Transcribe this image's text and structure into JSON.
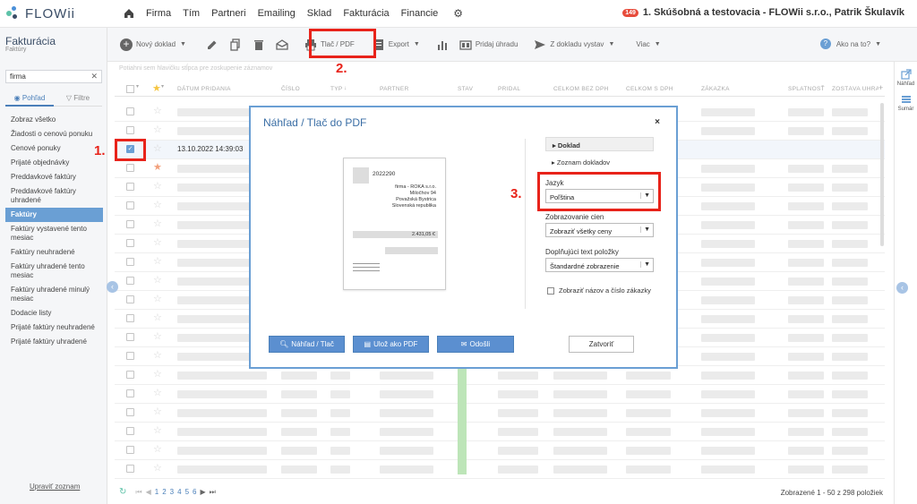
{
  "app": {
    "logo_text": "FLOWii",
    "nav": [
      "Firma",
      "Tím",
      "Partneri",
      "Emailing",
      "Sklad",
      "Fakturácia",
      "Financie"
    ],
    "company": "1. Skúšobná a testovacia - FLOWii s.r.o., Patrik Škulavík",
    "notif_count": "149"
  },
  "sidebar": {
    "title": "Fakturácia",
    "subtitle": "Faktúry",
    "search_value": "firma",
    "tab_view": "Pohľad",
    "tab_filter": "Filtre",
    "items": [
      "Zobraz všetko",
      "Žiadosti o cenovú ponuku",
      "Cenové ponuky",
      "Prijaté objednávky",
      "Preddavkové faktúry",
      "Preddavkové faktúry uhradené",
      "Faktúry",
      "Faktúry vystavené tento mesiac",
      "Faktúry neuhradené",
      "Faktúry uhradené tento mesiac",
      "Faktúry uhradené minulý mesiac",
      "Dodacie listy",
      "Prijaté faktúry neuhradené",
      "Prijaté faktúry uhradené"
    ],
    "active_item": "Faktúry",
    "footer_link": "Upraviť zoznam"
  },
  "toolbar": {
    "new_doc": "Nový doklad",
    "print_pdf": "Tlač / PDF",
    "export": "Export",
    "add_payment": "Pridaj úhradu",
    "from_doc": "Z dokladu vystav",
    "more": "Viac",
    "help": "Ako na to?"
  },
  "right_sidebar": {
    "preview": "Náhľad",
    "summary": "Sumár"
  },
  "table": {
    "filter_hint": "Potiahni sem hlavičku stĺpca pre zoskupenie záznamov",
    "headers": [
      "DÁTUM PRIDANIA",
      "ČÍSLO",
      "TYP",
      "PARTNER",
      "STAV",
      "PRIDAL",
      "CELKOM BEZ DPH",
      "CELKOM S DPH",
      "ZÁKAZKA",
      "SPLATNOSŤ",
      "ZOSTÁVA UHRADIŤ"
    ],
    "selected_date": "13.10.2022 14:39:03",
    "pages": [
      "1",
      "2",
      "3",
      "4",
      "5",
      "6"
    ],
    "count_text": "Zobrazené 1 - 50 z 298 položiek"
  },
  "modal": {
    "title": "Náhľad / Tlač do PDF",
    "close": "×",
    "preview_doc": {
      "number": "2022290",
      "address": [
        "firma - ROKA s.r.o.",
        "Miločhov 94",
        "Považská Bystrica",
        "Slovenská republika"
      ],
      "amount": "2.431,05 €"
    },
    "accordion": [
      "Doklad",
      "Zoznam dokladov"
    ],
    "lang_label": "Jazyk",
    "lang_value": "Poľština",
    "prices_label": "Zobrazovanie cien",
    "prices_value": "Zobraziť všetky ceny",
    "text_label": "Doplňujúci text položky",
    "text_value": "Štandardné zobrazenie",
    "checkbox_label": "Zobraziť názov a číslo zákazky",
    "btn_preview": "Náhľad / Tlač",
    "btn_save_pdf": "Ulož ako PDF",
    "btn_send": "Odošli",
    "btn_close": "Zatvoriť"
  },
  "annotations": [
    "1.",
    "2.",
    "3."
  ],
  "colors": {
    "accent": "#6a9fd4",
    "highlight": "#e8231a",
    "status_green": "#bde5b8"
  }
}
